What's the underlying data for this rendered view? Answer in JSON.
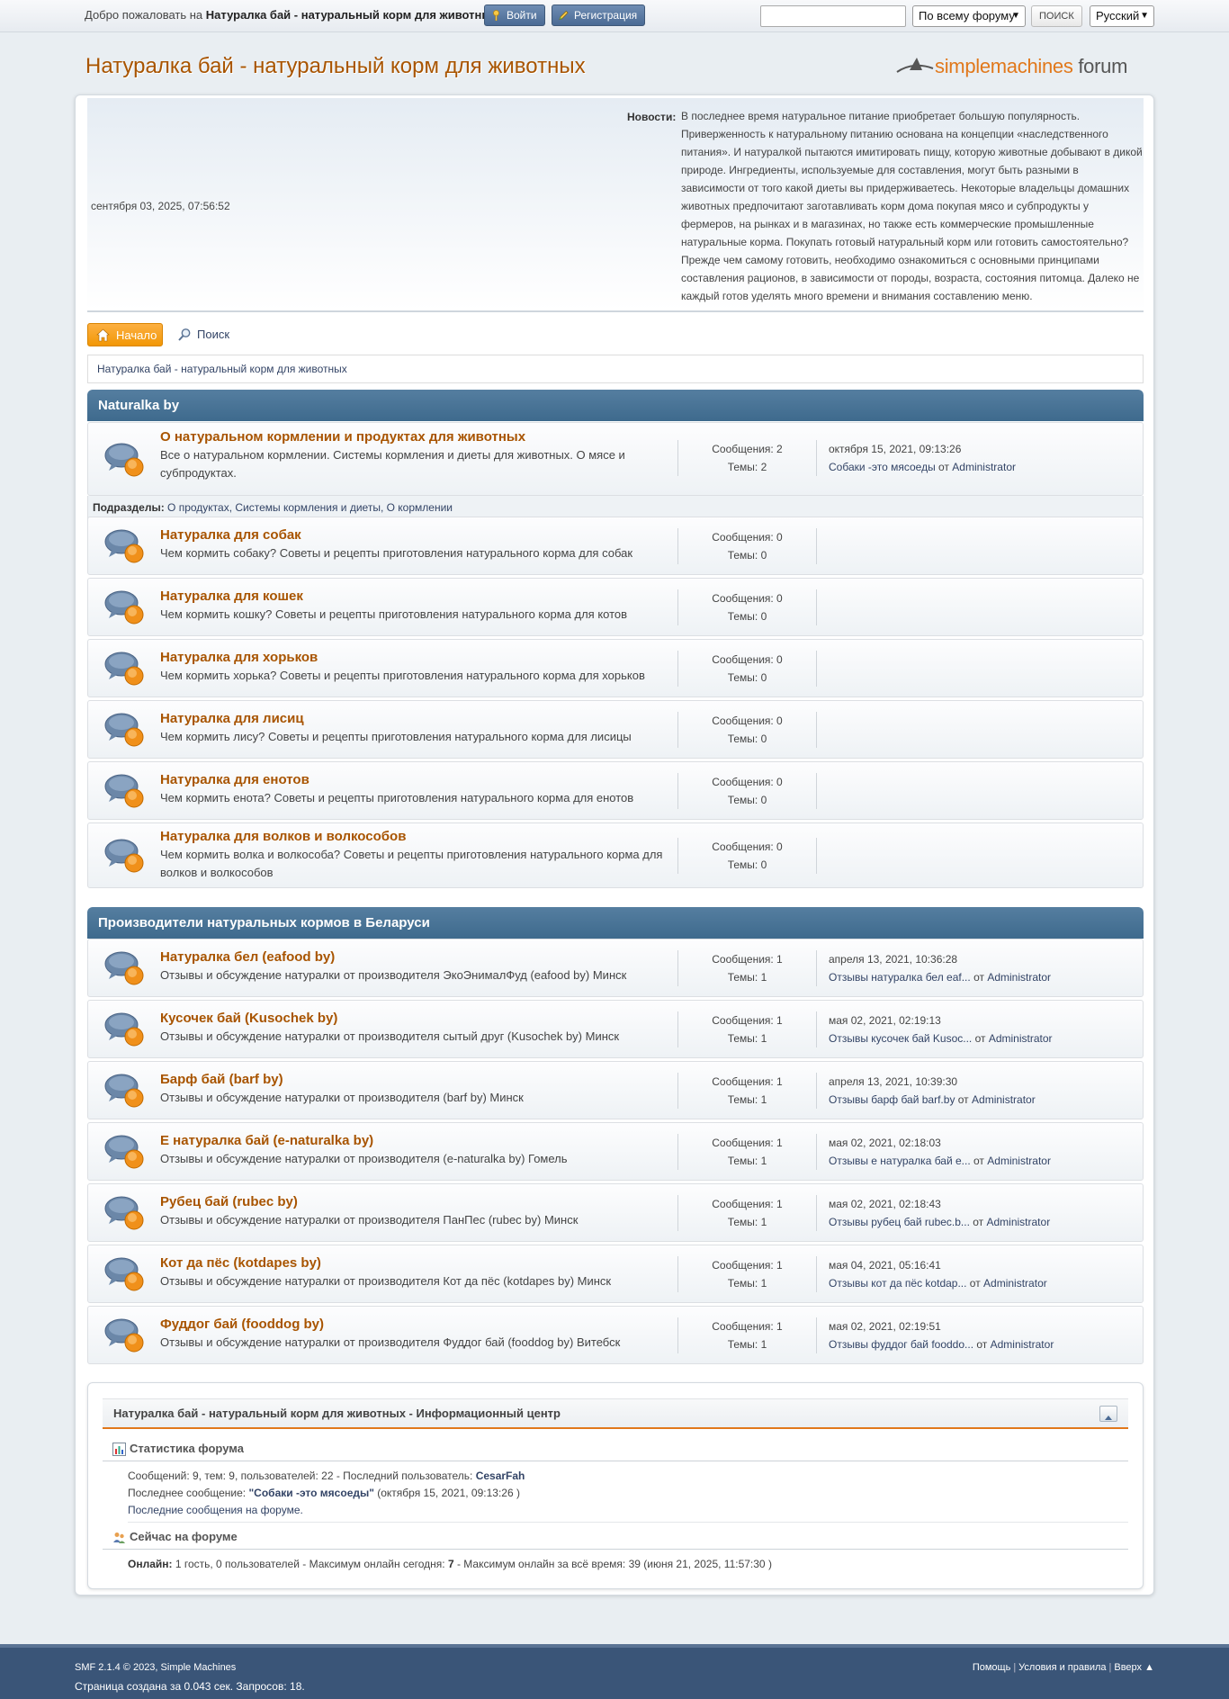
{
  "topbar": {
    "welcome_prefix": "Добро пожаловать на ",
    "welcome_site": "Натуралка бай - натуральный корм для животных",
    "welcome_suffix": ".",
    "login_label": "Войти",
    "register_label": "Регистрация",
    "search_value": "",
    "scope_select": "По всему форуму",
    "search_button": "ПОИСК",
    "language_select": "Русский"
  },
  "header": {
    "forum_title": "Натуралка бай - натуральный корм для животных",
    "logo_part1": "simple",
    "logo_part2": "machines",
    "logo_part3": " forum"
  },
  "upper": {
    "datetime": "сентября 03, 2025, 07:56:52",
    "news_label": "Новости:",
    "news_text": "В последнее время натуральное питание приобретает большую популярность. Приверженность к натуральному питанию основана на концепции «наследственного питания». И натуралкой пытаются имитировать пищу, которую животные добывают в дикой природе. Ингредиенты, используемые для составления, могут быть разными в зависимости от того какой диеты вы придерживаетесь. Некоторые владельцы домашних животных предпочитают заготавливать корм дома покупая мясо и субпродукты у фермеров, на рынках и в магазинах, но также есть коммерческие промышленные натуральные корма. Покупать готовый натуральный корм или готовить самостоятельно? Прежде чем самому готовить, необходимо ознакомиться с основными принципами составления рационов, в зависимости от породы, возраста, состояния питомца. Далеко не каждый готов уделять много времени и внимания составлению меню."
  },
  "menu": {
    "home_label": "Начало",
    "search_label": "Поиск"
  },
  "breadcrumb": "Натуралка бай - натуральный корм для животных",
  "categories": [
    {
      "title": "Naturalka by",
      "children_label": "Подразделы:",
      "children": "О продуктах, Системы кормления и диеты, О кормлении",
      "boards": [
        {
          "name": "О натуральном кормлении и продуктах для животных",
          "desc": "Все о натуральном кормлении. Системы кормления и диеты для животных. О мясе и субпродуктах.",
          "posts": "Сообщения: 2",
          "topics": "Темы: 2",
          "last_date": "октября 15, 2021, 09:13:26",
          "last_topic": "Собаки -это мясоеды",
          "last_by": " от ",
          "last_user": "Administrator"
        },
        {
          "name": "Натуралка для собак",
          "desc": "Чем кормить собаку? Советы и рецепты приготовления натурального корма для собак",
          "posts": "Сообщения: 0",
          "topics": "Темы: 0"
        },
        {
          "name": "Натуралка для кошек",
          "desc": "Чем кормить кошку? Советы и рецепты приготовления натурального корма для котов",
          "posts": "Сообщения: 0",
          "topics": "Темы: 0"
        },
        {
          "name": "Натуралка для хорьков",
          "desc": "Чем кормить хорька? Советы и рецепты приготовления натурального корма для хорьков",
          "posts": "Сообщения: 0",
          "topics": "Темы: 0"
        },
        {
          "name": "Натуралка для лисиц",
          "desc": "Чем кормить лису? Советы и рецепты приготовления натурального корма для лисицы",
          "posts": "Сообщения: 0",
          "topics": "Темы: 0"
        },
        {
          "name": "Натуралка для енотов",
          "desc": "Чем кормить енота? Советы и рецепты приготовления натурального корма для енотов",
          "posts": "Сообщения: 0",
          "topics": "Темы: 0"
        },
        {
          "name": "Натуралка для волков и волкособов",
          "desc": "Чем кормить волка и волкособа? Советы и рецепты приготовления натурального корма для волков и волкособов",
          "posts": "Сообщения: 0",
          "topics": "Темы: 0"
        }
      ]
    },
    {
      "title": "Производители натуральных кормов в Беларуси",
      "boards": [
        {
          "name": "Натуралка бел (eafood by)",
          "desc": "Отзывы и обсуждение натуралки от  производителя ЭкоЭнималФуд (eafood by) Минск",
          "posts": "Сообщения: 1",
          "topics": "Темы: 1",
          "last_date": "апреля 13, 2021, 10:36:28",
          "last_topic": "Отзывы натуралка бел eaf...",
          "last_by": " от ",
          "last_user": "Administrator"
        },
        {
          "name": "Кусочек бай (Kusochek by)",
          "desc": "Отзывы и обсуждение натуралки от производителя сытый друг (Kusochek by) Минск",
          "posts": "Сообщения: 1",
          "topics": "Темы: 1",
          "last_date": "мая 02, 2021, 02:19:13",
          "last_topic": "Отзывы кусочек бай Kusoc...",
          "last_by": " от ",
          "last_user": "Administrator"
        },
        {
          "name": "Барф бай (barf by)",
          "desc": "Отзывы и обсуждение натуралки от производителя (barf by) Минск",
          "posts": "Сообщения: 1",
          "topics": "Темы: 1",
          "last_date": "апреля 13, 2021, 10:39:30",
          "last_topic": "Отзывы барф бай barf.by",
          "last_by": " от ",
          "last_user": "Administrator"
        },
        {
          "name": "Е натуралка бай (e-naturalka by)",
          "desc": "Отзывы и обсуждение натуралки от производителя (e-naturalka by) Гомель",
          "posts": "Сообщения: 1",
          "topics": "Темы: 1",
          "last_date": "мая 02, 2021, 02:18:03",
          "last_topic": "Отзывы е натуралка бай е...",
          "last_by": " от ",
          "last_user": "Administrator"
        },
        {
          "name": "Рубец бай (rubec by)",
          "desc": "Отзывы и обсуждение натуралки от производителя ПанПес (rubec by) Минск",
          "posts": "Сообщения: 1",
          "topics": "Темы: 1",
          "last_date": "мая 02, 2021, 02:18:43",
          "last_topic": "Отзывы рубец бай rubec.b...",
          "last_by": " от ",
          "last_user": "Administrator"
        },
        {
          "name": "Кот да пёс (kotdapes by)",
          "desc": "Отзывы и обсуждение натуралки от производителя Кот да пёс (kotdapes by)  Минск",
          "posts": "Сообщения: 1",
          "topics": "Темы: 1",
          "last_date": "мая 04, 2021, 05:16:41",
          "last_topic": "Отзывы кот да пёс kotdap...",
          "last_by": " от ",
          "last_user": "Administrator"
        },
        {
          "name": "Фуддог бай (fooddog by)",
          "desc": "Отзывы и обсуждение натуралки от производителя Фуддог бай (fooddog by) Витебск",
          "posts": "Сообщения: 1",
          "topics": "Темы: 1",
          "last_date": "мая 02, 2021, 02:19:51",
          "last_topic": "Отзывы фуддог бай fooddo...",
          "last_by": " от ",
          "last_user": "Administrator"
        }
      ]
    }
  ],
  "info_center": {
    "title": "Натуралка бай - натуральный корм для животных - Информационный центр",
    "stats_title": "Статистика форума",
    "stats_line1": "Сообщений: 9, тем: 9, пользователей: 22 - Последний пользователь: ",
    "latest_member": "CesarFah",
    "stats_line2_prefix": "Последнее сообщение: ",
    "last_post_title": "\"Собаки -это мясоеды\"",
    "stats_line2_suffix": " (октября 15, 2021, 09:13:26 )",
    "recent_posts_link": "Последние сообщения на форуме.",
    "online_title": "Сейчас на форуме",
    "online_label": "Онлайн:",
    "online_text1": " 1 гость, 0 пользователей  - Максимум онлайн сегодня: ",
    "online_today": "7",
    "online_text2": " -  Максимум онлайн за всё время: 39 (июня 21, 2025, 11:57:30 )"
  },
  "footer": {
    "copyright_prefix": "SMF 2.1.4 © 2023, ",
    "copyright_link": "Simple Machines",
    "page_stats": "Страница создана за 0.043 сек. Запросов: 18.",
    "help": "Помощь",
    "terms": "Условия и правила",
    "top": "Вверх ▲",
    "separator": "|"
  },
  "colors": {
    "accent_orange": "#a85400",
    "category_blue": "#3e6a8d",
    "footer_blue": "#3a5578",
    "home_button": "#f29705"
  }
}
